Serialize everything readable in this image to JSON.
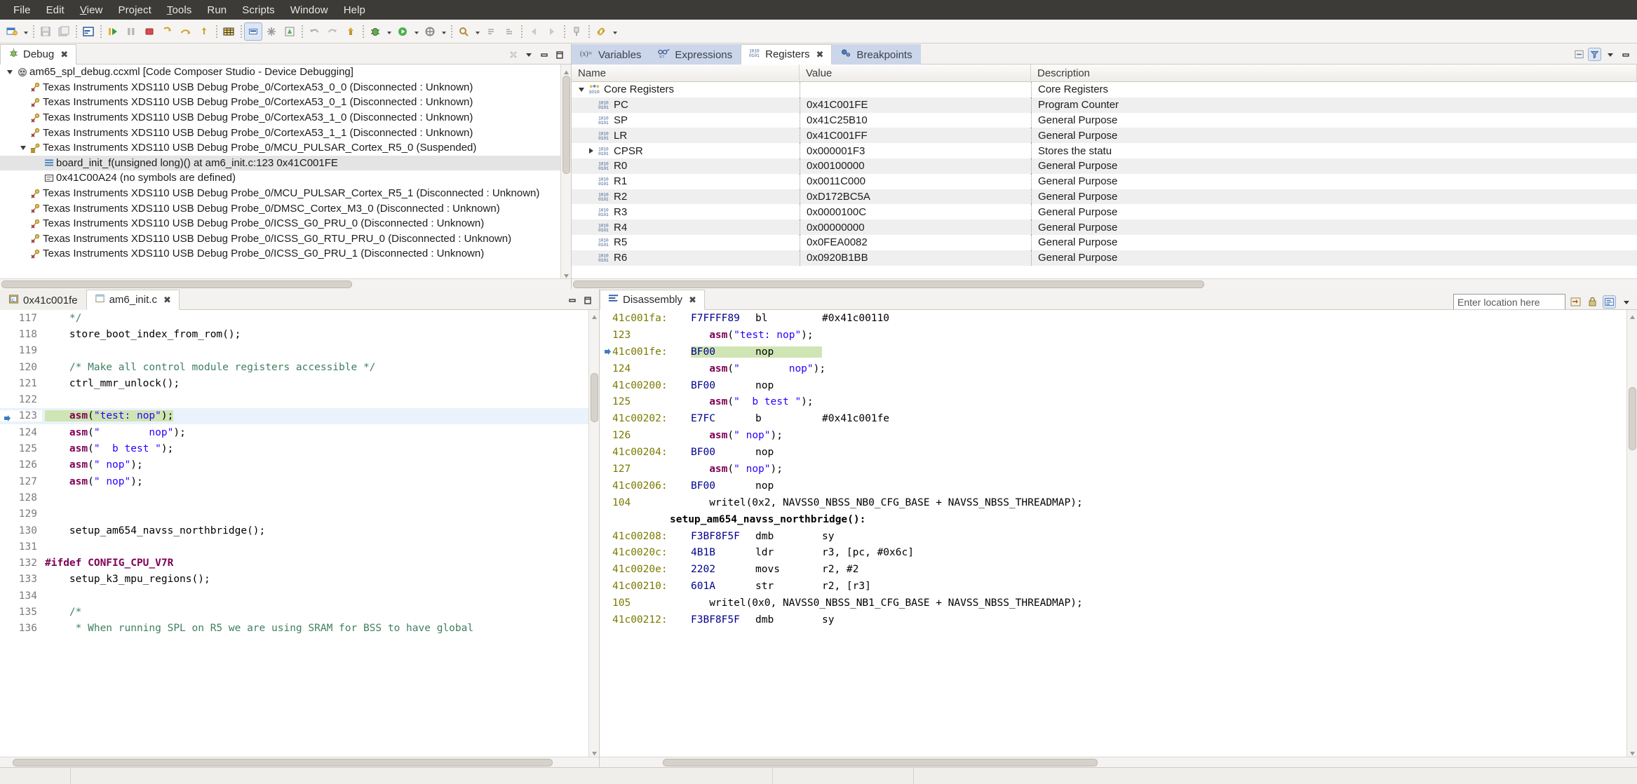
{
  "menubar": {
    "items": [
      "File",
      "Edit",
      "View",
      "Project",
      "Tools",
      "Run",
      "Scripts",
      "Window",
      "Help"
    ]
  },
  "toolbar": {
    "icons": [
      "new-file-icon",
      "dropdown-arrow",
      "save-icon",
      "save-all-icon",
      "print-icon",
      "separator",
      "console-icon",
      "separator",
      "resume-icon",
      "suspend-icon",
      "terminate-icon",
      "step-into-icon",
      "step-over-icon",
      "step-return-icon",
      "separator",
      "grid-icon",
      "memory-browser-icon",
      "assembly-step-icon",
      "breakpoint-icon",
      "separator",
      "undo-icon",
      "redo-icon",
      "build-icon",
      "separator",
      "debug-icon",
      "dropdown-arrow",
      "run-icon",
      "dropdown-arrow",
      "external-tools-icon",
      "dropdown-arrow",
      "separator",
      "search-icon",
      "dropdown-arrow",
      "next-annotation-icon",
      "previous-annotation-icon",
      "separator",
      "pin-icon",
      "separator",
      "back-icon",
      "forward-icon",
      "separator",
      "link-icon",
      "dropdown-arrow"
    ]
  },
  "debug_view": {
    "tab_label": "Debug",
    "tab_icon": "bug-icon",
    "toolbar_icons": [
      "disconnect-icon",
      "view-menu-icon",
      "minimize-icon",
      "maximize-icon"
    ],
    "tree": [
      {
        "indent": 0,
        "expander": "down",
        "icon": "launch-config-icon",
        "label": "am65_spl_debug.ccxml [Code Composer Studio - Device Debugging]",
        "selected": false
      },
      {
        "indent": 1,
        "expander": "none",
        "icon": "disconnected-core-icon",
        "label": "Texas Instruments XDS110 USB Debug Probe_0/CortexA53_0_0 (Disconnected : Unknown)",
        "selected": false
      },
      {
        "indent": 1,
        "expander": "none",
        "icon": "disconnected-core-icon",
        "label": "Texas Instruments XDS110 USB Debug Probe_0/CortexA53_0_1 (Disconnected : Unknown)",
        "selected": false
      },
      {
        "indent": 1,
        "expander": "none",
        "icon": "disconnected-core-icon",
        "label": "Texas Instruments XDS110 USB Debug Probe_0/CortexA53_1_0 (Disconnected : Unknown)",
        "selected": false
      },
      {
        "indent": 1,
        "expander": "none",
        "icon": "disconnected-core-icon",
        "label": "Texas Instruments XDS110 USB Debug Probe_0/CortexA53_1_1 (Disconnected : Unknown)",
        "selected": false
      },
      {
        "indent": 1,
        "expander": "down",
        "icon": "suspended-core-icon",
        "label": "Texas Instruments XDS110 USB Debug Probe_0/MCU_PULSAR_Cortex_R5_0 (Suspended)",
        "selected": false
      },
      {
        "indent": 2,
        "expander": "none",
        "icon": "stack-frame-icon",
        "label": "board_init_f(unsigned long)() at am6_init.c:123 0x41C001FE",
        "selected": true
      },
      {
        "indent": 2,
        "expander": "none",
        "icon": "stack-frame-nosym-icon",
        "label": "0x41C00A24 (no symbols are defined)",
        "selected": false
      },
      {
        "indent": 1,
        "expander": "none",
        "icon": "disconnected-core-icon",
        "label": "Texas Instruments XDS110 USB Debug Probe_0/MCU_PULSAR_Cortex_R5_1 (Disconnected : Unknown)",
        "selected": false
      },
      {
        "indent": 1,
        "expander": "none",
        "icon": "disconnected-core-icon",
        "label": "Texas Instruments XDS110 USB Debug Probe_0/DMSC_Cortex_M3_0 (Disconnected : Unknown)",
        "selected": false
      },
      {
        "indent": 1,
        "expander": "none",
        "icon": "disconnected-core-icon",
        "label": "Texas Instruments XDS110 USB Debug Probe_0/ICSS_G0_PRU_0 (Disconnected : Unknown)",
        "selected": false
      },
      {
        "indent": 1,
        "expander": "none",
        "icon": "disconnected-core-icon",
        "label": "Texas Instruments XDS110 USB Debug Probe_0/ICSS_G0_RTU_PRU_0 (Disconnected : Unknown)",
        "selected": false
      },
      {
        "indent": 1,
        "expander": "none",
        "icon": "disconnected-core-icon",
        "label": "Texas Instruments XDS110 USB Debug Probe_0/ICSS_G0_PRU_1 (Disconnected : Unknown)",
        "selected": false
      }
    ]
  },
  "registers_view": {
    "tabs": [
      {
        "label": "Variables",
        "icon": "variables-icon",
        "active": false,
        "closable": false
      },
      {
        "label": "Expressions",
        "icon": "expressions-icon",
        "active": false,
        "closable": false
      },
      {
        "label": "Registers",
        "icon": "registers-icon",
        "active": true,
        "closable": true
      },
      {
        "label": "Breakpoints",
        "icon": "breakpoints-icon",
        "active": false,
        "closable": false
      }
    ],
    "toolbar_icons": [
      "collapse-all-icon",
      "view-menu-icon",
      "minimize-icon"
    ],
    "columns": [
      "Name",
      "Value",
      "Description"
    ],
    "rows": [
      {
        "indent": 0,
        "expander": "down",
        "icon": "register-group-icon",
        "name": "Core Registers",
        "value": "",
        "description": "Core Registers"
      },
      {
        "indent": 1,
        "expander": "none",
        "icon": "register-icon",
        "name": "PC",
        "value": "0x41C001FE",
        "description": "Program Counter"
      },
      {
        "indent": 1,
        "expander": "none",
        "icon": "register-icon",
        "name": "SP",
        "value": "0x41C25B10",
        "description": "General Purpose"
      },
      {
        "indent": 1,
        "expander": "none",
        "icon": "register-icon",
        "name": "LR",
        "value": "0x41C001FF",
        "description": "General Purpose"
      },
      {
        "indent": 1,
        "expander": "right",
        "icon": "register-icon",
        "name": "CPSR",
        "value": "0x000001F3",
        "description": "Stores the statu"
      },
      {
        "indent": 1,
        "expander": "none",
        "icon": "register-icon",
        "name": "R0",
        "value": "0x00100000",
        "description": "General Purpose"
      },
      {
        "indent": 1,
        "expander": "none",
        "icon": "register-icon",
        "name": "R1",
        "value": "0x0011C000",
        "description": "General Purpose"
      },
      {
        "indent": 1,
        "expander": "none",
        "icon": "register-icon",
        "name": "R2",
        "value": "0xD172BC5A",
        "description": "General Purpose"
      },
      {
        "indent": 1,
        "expander": "none",
        "icon": "register-icon",
        "name": "R3",
        "value": "0x0000100C",
        "description": "General Purpose"
      },
      {
        "indent": 1,
        "expander": "none",
        "icon": "register-icon",
        "name": "R4",
        "value": "0x00000000",
        "description": "General Purpose"
      },
      {
        "indent": 1,
        "expander": "none",
        "icon": "register-icon",
        "name": "R5",
        "value": "0x0FEA0082",
        "description": "General Purpose"
      },
      {
        "indent": 1,
        "expander": "none",
        "icon": "register-icon",
        "name": "R6",
        "value": "0x0920B1BB",
        "description": "General Purpose"
      }
    ]
  },
  "editor_view": {
    "tabs": [
      {
        "label": "0x41c001fe",
        "icon": "disassembly-editor-icon",
        "active": false,
        "closable": false
      },
      {
        "label": "am6_init.c",
        "icon": "c-file-icon",
        "active": true,
        "closable": true
      }
    ],
    "toolbar_icons": [
      "minimize-icon",
      "maximize-icon"
    ],
    "lines": [
      {
        "num": "117",
        "marker": "",
        "current": false,
        "segments": [
          {
            "t": "    */",
            "c": "cmt"
          }
        ]
      },
      {
        "num": "118",
        "marker": "",
        "current": false,
        "segments": [
          {
            "t": "    store_boot_index_from_rom();",
            "c": "pl"
          }
        ]
      },
      {
        "num": "119",
        "marker": "",
        "current": false,
        "segments": [
          {
            "t": "",
            "c": "pl"
          }
        ]
      },
      {
        "num": "120",
        "marker": "",
        "current": false,
        "segments": [
          {
            "t": "    /* Make all control module registers accessible */",
            "c": "cmt"
          }
        ]
      },
      {
        "num": "121",
        "marker": "",
        "current": false,
        "segments": [
          {
            "t": "    ctrl_mmr_unlock();",
            "c": "pl"
          }
        ]
      },
      {
        "num": "122",
        "marker": "",
        "current": false,
        "segments": [
          {
            "t": "",
            "c": "pl"
          }
        ]
      },
      {
        "num": "123",
        "marker": "current-instruction",
        "current": true,
        "highlight": true,
        "segments": [
          {
            "t": "    ",
            "c": "pl"
          },
          {
            "t": "asm",
            "c": "kw"
          },
          {
            "t": "(",
            "c": "pl"
          },
          {
            "t": "\"test: nop\"",
            "c": "str"
          },
          {
            "t": ");",
            "c": "pl"
          }
        ]
      },
      {
        "num": "124",
        "marker": "",
        "current": false,
        "segments": [
          {
            "t": "    ",
            "c": "pl"
          },
          {
            "t": "asm",
            "c": "kw"
          },
          {
            "t": "(",
            "c": "pl"
          },
          {
            "t": "\"        nop\"",
            "c": "str"
          },
          {
            "t": ");",
            "c": "pl"
          }
        ]
      },
      {
        "num": "125",
        "marker": "",
        "current": false,
        "segments": [
          {
            "t": "    ",
            "c": "pl"
          },
          {
            "t": "asm",
            "c": "kw"
          },
          {
            "t": "(",
            "c": "pl"
          },
          {
            "t": "\"  b test \"",
            "c": "str"
          },
          {
            "t": ");",
            "c": "pl"
          }
        ]
      },
      {
        "num": "126",
        "marker": "",
        "current": false,
        "segments": [
          {
            "t": "    ",
            "c": "pl"
          },
          {
            "t": "asm",
            "c": "kw"
          },
          {
            "t": "(",
            "c": "pl"
          },
          {
            "t": "\" nop\"",
            "c": "str"
          },
          {
            "t": ");",
            "c": "pl"
          }
        ]
      },
      {
        "num": "127",
        "marker": "",
        "current": false,
        "segments": [
          {
            "t": "    ",
            "c": "pl"
          },
          {
            "t": "asm",
            "c": "kw"
          },
          {
            "t": "(",
            "c": "pl"
          },
          {
            "t": "\" nop\"",
            "c": "str"
          },
          {
            "t": ");",
            "c": "pl"
          }
        ]
      },
      {
        "num": "128",
        "marker": "",
        "current": false,
        "segments": [
          {
            "t": "",
            "c": "pl"
          }
        ]
      },
      {
        "num": "129",
        "marker": "",
        "current": false,
        "segments": [
          {
            "t": "",
            "c": "pl"
          }
        ]
      },
      {
        "num": "130",
        "marker": "",
        "current": false,
        "segments": [
          {
            "t": "    setup_am654_navss_northbridge();",
            "c": "pl"
          }
        ]
      },
      {
        "num": "131",
        "marker": "",
        "current": false,
        "segments": [
          {
            "t": "",
            "c": "pl"
          }
        ]
      },
      {
        "num": "132",
        "marker": "",
        "current": false,
        "segments": [
          {
            "t": "#ifdef CONFIG_CPU_V7R",
            "c": "pp"
          }
        ]
      },
      {
        "num": "133",
        "marker": "",
        "current": false,
        "segments": [
          {
            "t": "    setup_k3_mpu_regions();",
            "c": "pl"
          }
        ]
      },
      {
        "num": "134",
        "marker": "",
        "current": false,
        "segments": [
          {
            "t": "",
            "c": "pl"
          }
        ]
      },
      {
        "num": "135",
        "marker": "",
        "current": false,
        "segments": [
          {
            "t": "    /*",
            "c": "cmt"
          }
        ]
      },
      {
        "num": "136",
        "marker": "",
        "current": false,
        "segments": [
          {
            "t": "     * When running SPL on R5 we are using SRAM for BSS to have global",
            "c": "cmt"
          }
        ]
      }
    ]
  },
  "disassembly_view": {
    "tab_label": "Disassembly",
    "tab_icon": "disassembly-icon",
    "location_placeholder": "Enter location here",
    "location_value": "",
    "toolbar_icons": [
      "go-to-pc-icon",
      "lock-icon",
      "toggle-source-icon",
      "view-menu-icon"
    ],
    "lines": [
      {
        "kind": "asm",
        "marker": "",
        "addr": "41c001fa:",
        "opcode": "F7FFFF89",
        "mnemonic": "bl",
        "args": "#0x41c00110",
        "highlight": false
      },
      {
        "kind": "src",
        "num": "123",
        "text": "   asm(\"test: nop\");"
      },
      {
        "kind": "asm",
        "marker": "current-instruction",
        "addr": "41c001fe:",
        "opcode": "BF00",
        "mnemonic": "nop",
        "args": "",
        "highlight": true
      },
      {
        "kind": "src",
        "num": "124",
        "text": "   asm(\"        nop\");"
      },
      {
        "kind": "asm",
        "marker": "",
        "addr": "41c00200:",
        "opcode": "BF00",
        "mnemonic": "nop",
        "args": "",
        "highlight": false
      },
      {
        "kind": "src",
        "num": "125",
        "text": "   asm(\"  b test \");"
      },
      {
        "kind": "asm",
        "marker": "",
        "addr": "41c00202:",
        "opcode": "E7FC",
        "mnemonic": "b",
        "args": "#0x41c001fe",
        "highlight": false
      },
      {
        "kind": "src",
        "num": "126",
        "text": "   asm(\" nop\");"
      },
      {
        "kind": "asm",
        "marker": "",
        "addr": "41c00204:",
        "opcode": "BF00",
        "mnemonic": "nop",
        "args": "",
        "highlight": false
      },
      {
        "kind": "src",
        "num": "127",
        "text": "   asm(\" nop\");"
      },
      {
        "kind": "asm",
        "marker": "",
        "addr": "41c00206:",
        "opcode": "BF00",
        "mnemonic": "nop",
        "args": "",
        "highlight": false
      },
      {
        "kind": "src",
        "num": "104",
        "text": "   writel(0x2, NAVSS0_NBSS_NB0_CFG_BASE + NAVSS_NBSS_THREADMAP);"
      },
      {
        "kind": "label",
        "text": "setup_am654_navss_northbridge():"
      },
      {
        "kind": "asm",
        "marker": "",
        "addr": "41c00208:",
        "opcode": "F3BF8F5F",
        "mnemonic": "dmb",
        "args": "sy",
        "highlight": false
      },
      {
        "kind": "asm",
        "marker": "",
        "addr": "41c0020c:",
        "opcode": "4B1B",
        "mnemonic": "ldr",
        "args": "r3, [pc, #0x6c]",
        "highlight": false
      },
      {
        "kind": "asm",
        "marker": "",
        "addr": "41c0020e:",
        "opcode": "2202",
        "mnemonic": "movs",
        "args": "r2, #2",
        "highlight": false
      },
      {
        "kind": "asm",
        "marker": "",
        "addr": "41c00210:",
        "opcode": "601A",
        "mnemonic": "str",
        "args": "r2, [r3]",
        "highlight": false
      },
      {
        "kind": "src",
        "num": "105",
        "text": "   writel(0x0, NAVSS0_NBSS_NB1_CFG_BASE + NAVSS_NBSS_THREADMAP);"
      },
      {
        "kind": "asm",
        "marker": "",
        "addr": "41c00212:",
        "opcode": "F3BF8F5F",
        "mnemonic": "dmb",
        "args": "sy",
        "highlight": false
      }
    ]
  },
  "colors": {
    "menubar_bg": "#3c3b37",
    "tab_inactive_bg": "#ccd6ea",
    "selection_bg": "#e4e4e4",
    "current_line_bg": "#eaf2fb",
    "pc_highlight_bg": "#cfe5b4",
    "keyword": "#7f0055",
    "string": "#2a00ff",
    "comment": "#3f7f5f",
    "disasm_address": "#7a7a00",
    "disasm_opcode": "#00008b"
  }
}
